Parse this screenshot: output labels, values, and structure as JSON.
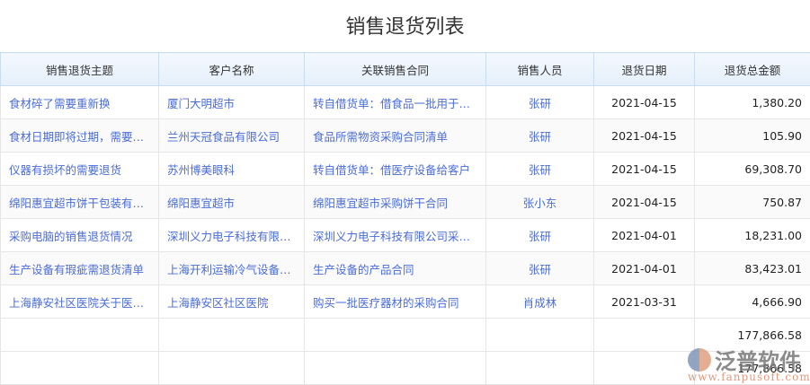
{
  "title": "销售退货列表",
  "columns": [
    "销售退货主题",
    "客户名称",
    "关联销售合同",
    "销售人员",
    "退货日期",
    "退货总金额"
  ],
  "rows": [
    [
      "食材碎了需要重新换",
      "厦门大明超市",
      "转自借货单：借食品一批用于展示",
      "张研",
      "2021-04-15",
      "1,380.20"
    ],
    [
      "食材日期即将过期，需要退货",
      "兰州天冠食品有限公司",
      "食品所需物资采购合同清单",
      "张研",
      "2021-04-15",
      "105.90"
    ],
    [
      "仪器有损坏的需要退货",
      "苏州博美眼科",
      "转自借货单：借医疗设备给客户",
      "张研",
      "2021-04-15",
      "69,308.70"
    ],
    [
      "绵阳惠宜超市饼干包装有破损",
      "绵阳惠宜超市",
      "绵阳惠宜超市采购饼干合同",
      "张小东",
      "2021-04-15",
      "750.87"
    ],
    [
      "采购电脑的销售退货情况",
      "深圳义力电子科技有限公司",
      "深圳义力电子科技有限公司采购合同",
      "张研",
      "2021-04-01",
      "18,231.00"
    ],
    [
      "生产设备有瑕疵需退货清单",
      "上海开利运输冷气设备有限公司",
      "生产设备的产品合同",
      "张研",
      "2021-04-01",
      "83,423.01"
    ],
    [
      "上海静安社区医院关于医疗器材退货",
      "上海静安区社区医院",
      "购买一批医疗器材的采购合同",
      "肖成林",
      "2021-03-31",
      "4,666.90"
    ]
  ],
  "totals": [
    "177,866.58",
    "177,866.58"
  ],
  "watermark": {
    "name": "泛普软件",
    "url": "www.fanpusoft.com"
  }
}
